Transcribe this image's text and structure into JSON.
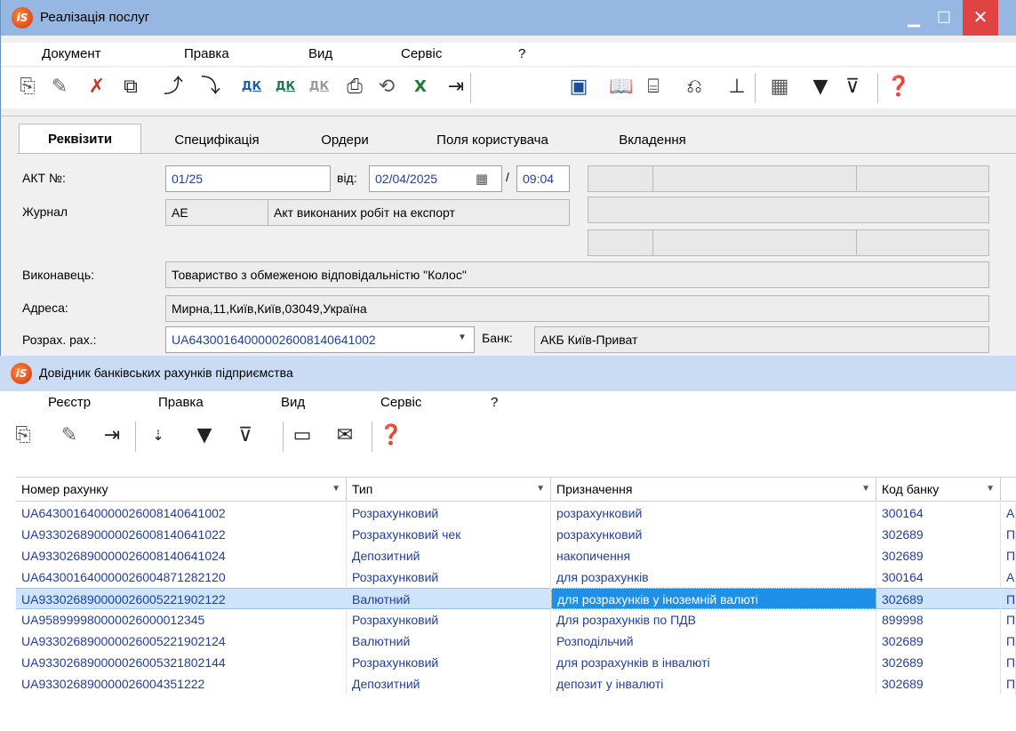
{
  "win1": {
    "title": "Реалізація послуг",
    "logo": "iS",
    "menu": [
      "Документ",
      "Правка",
      "Вид",
      "Сервіс",
      "?"
    ],
    "toolbar_icons": [
      "new-icon",
      "edit-icon",
      "delete-icon",
      "copy-icon",
      "export-icon",
      "import-icon",
      "dk-icon",
      "dk-icon",
      "dk-dim-icon",
      "print-icon",
      "excel-icon",
      "exit-icon",
      "save-icon",
      "book-icon",
      "attach-icon",
      "link-icon",
      "tree-icon",
      "table-icon",
      "filter-icon",
      "clear-filter-icon",
      "help-icon"
    ],
    "tabs": [
      "Реквізити",
      "Специфікація",
      "Ордери",
      "Поля користувача",
      "Вкладення"
    ],
    "labels": {
      "act_no": "АКТ №:",
      "from": "від:",
      "slash": "/",
      "journal": "Журнал",
      "executor": "Виконавець:",
      "address": "Адреса:",
      "account": "Розрах. рах.:",
      "bank": "Банк:"
    },
    "values": {
      "act_no": "01/25",
      "date": "02/04/2025",
      "time": "09:04",
      "journal_code": "АЕ",
      "journal_name": "Акт виконаних робіт на експорт",
      "executor": "Товариство з обмеженою відповідальністю \"Колос\"",
      "address": "Мирна,11,Київ,Київ,03049,Україна",
      "account": "UA643001640000026008140641002",
      "bank": "АКБ Київ-Приват"
    }
  },
  "win2": {
    "title": "Довідник банківських рахунків підприємства",
    "logo": "iS",
    "menu": [
      "Реєстр",
      "Правка",
      "Вид",
      "Сервіс",
      "?"
    ],
    "columns": [
      "Номер рахунку",
      "Тип",
      "Призначення",
      "Код банку"
    ],
    "rows": [
      {
        "account": "UA643001640000026008140641002",
        "type": "Розрахунковий",
        "purpose": "розрахунковий",
        "bank_code": "300164",
        "extra": "А"
      },
      {
        "account": "UA933026890000026008140641022",
        "type": "Розрахунковий чек",
        "purpose": "розрахунковий",
        "bank_code": "302689",
        "extra": "П"
      },
      {
        "account": "UA933026890000026008140641024",
        "type": "Депозитний",
        "purpose": "накопичення",
        "bank_code": "302689",
        "extra": "П"
      },
      {
        "account": "UA643001640000026004871282120",
        "type": "Розрахунковий",
        "purpose": "для розрахунків",
        "bank_code": "300164",
        "extra": "А"
      },
      {
        "account": "UA933026890000026005221902122",
        "type": "Валютний",
        "purpose": "для розрахунків у іноземній валюті",
        "bank_code": "302689",
        "extra": "П"
      },
      {
        "account": "UA958999980000026000012345",
        "type": "Розрахунковий",
        "purpose": "Для розрахунків по ПДВ",
        "bank_code": "899998",
        "extra": "П"
      },
      {
        "account": "UA933026890000026005221902124",
        "type": "Валютний",
        "purpose": "Розподільчий",
        "bank_code": "302689",
        "extra": "П"
      },
      {
        "account": "UA933026890000026005321802144",
        "type": "Розрахунковий",
        "purpose": "для розрахунків в інвалюті",
        "bank_code": "302689",
        "extra": "П"
      },
      {
        "account": "UA933026890000026004351222",
        "type": "Депозитний",
        "purpose": "депозит у інвалюті",
        "bank_code": "302689",
        "extra": "П"
      }
    ],
    "selected_row": 4
  }
}
